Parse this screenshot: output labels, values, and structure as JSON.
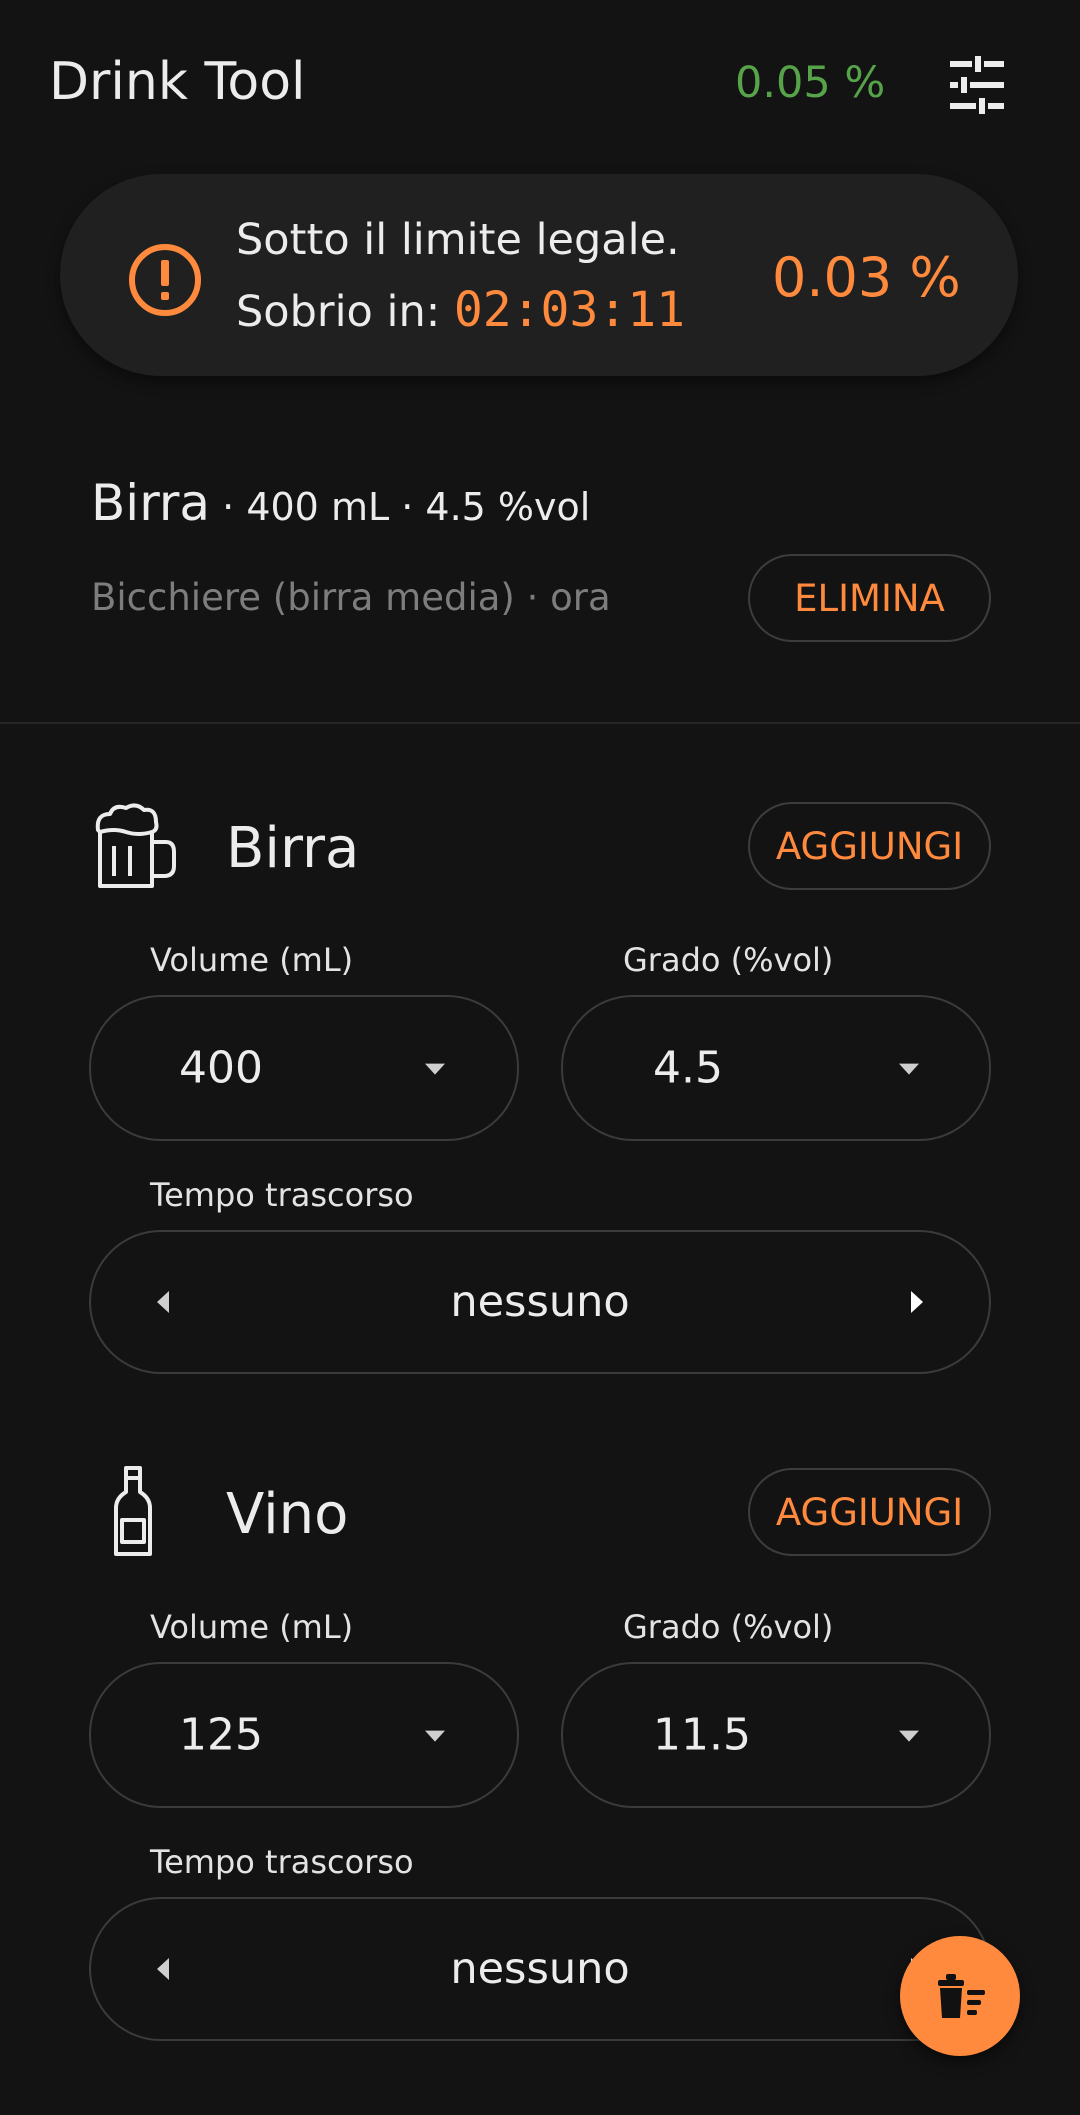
{
  "appbar": {
    "title": "Drink Tool",
    "legal_limit": "0.05 %",
    "settings_icon": "tune-sliders-icon"
  },
  "banner": {
    "icon": "alert-circle-icon",
    "line1": "Sotto il limite legale.",
    "line2_prefix": "Sobrio in:",
    "timer": "02:03:11",
    "current_bac": "0.03 %"
  },
  "last_entry": {
    "name": "Birra",
    "sep1": " · ",
    "volume": "400",
    "volume_unit": " mL",
    "sep2": " · ",
    "abv": "4.5 %vol",
    "subtitle": "Bicchiere (birra media) · ora",
    "delete_label": "ELIMINA"
  },
  "drinks": [
    {
      "name": "Birra",
      "icon": "beer-mug-icon",
      "add_label": "AGGIUNGI",
      "volume_label": "Volume (mL)",
      "volume_value": "400",
      "abv_label": "Grado (%vol)",
      "abv_value": "4.5",
      "time_label": "Tempo trascorso",
      "time_value": "nessuno"
    },
    {
      "name": "Vino",
      "icon": "wine-bottle-icon",
      "add_label": "AGGIUNGI",
      "volume_label": "Volume (mL)",
      "volume_value": "125",
      "abv_label": "Grado (%vol)",
      "abv_value": "11.5",
      "time_label": "Tempo trascorso",
      "time_value": "nessuno"
    }
  ],
  "fab": {
    "icon": "delete-sweep-icon"
  },
  "colors": {
    "background": "#131313",
    "accent": "#ff8a3d",
    "ok_green": "#56a34a",
    "card": "#202020"
  }
}
